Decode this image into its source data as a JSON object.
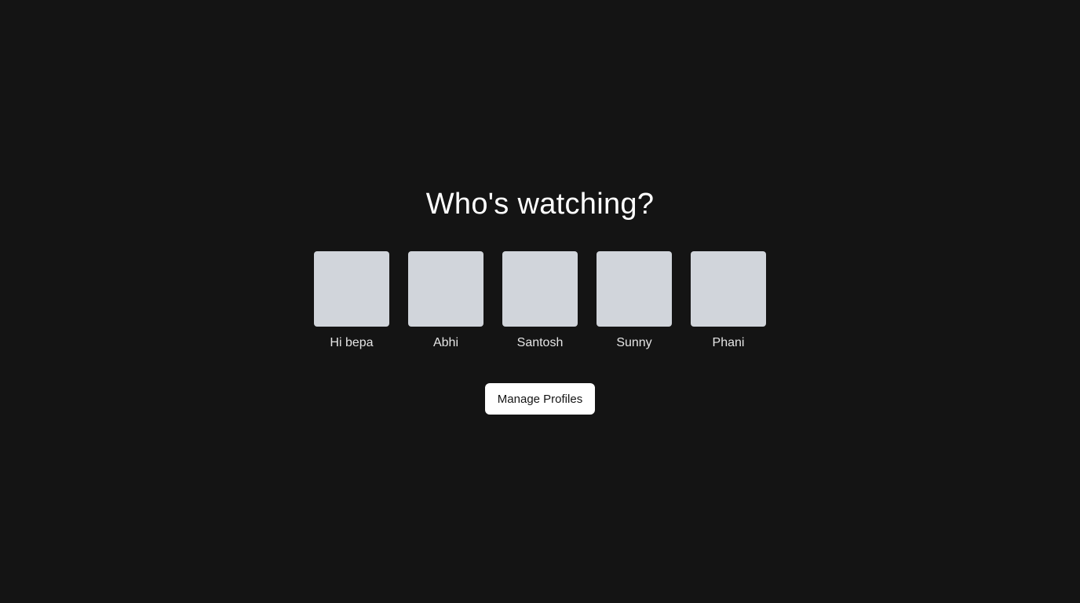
{
  "page": {
    "title": "Who's watching?",
    "background_color": "#141414"
  },
  "profiles": [
    {
      "name": "Hi bepa",
      "avatar_color": "#d1d5db"
    },
    {
      "name": "Abhi",
      "avatar_color": "#d1d5db"
    },
    {
      "name": "Santosh",
      "avatar_color": "#d1d5db"
    },
    {
      "name": "Sunny",
      "avatar_color": "#d1d5db"
    },
    {
      "name": "Phani",
      "avatar_color": "#d1d5db"
    }
  ],
  "manage_button": {
    "label": "Manage Profiles"
  }
}
